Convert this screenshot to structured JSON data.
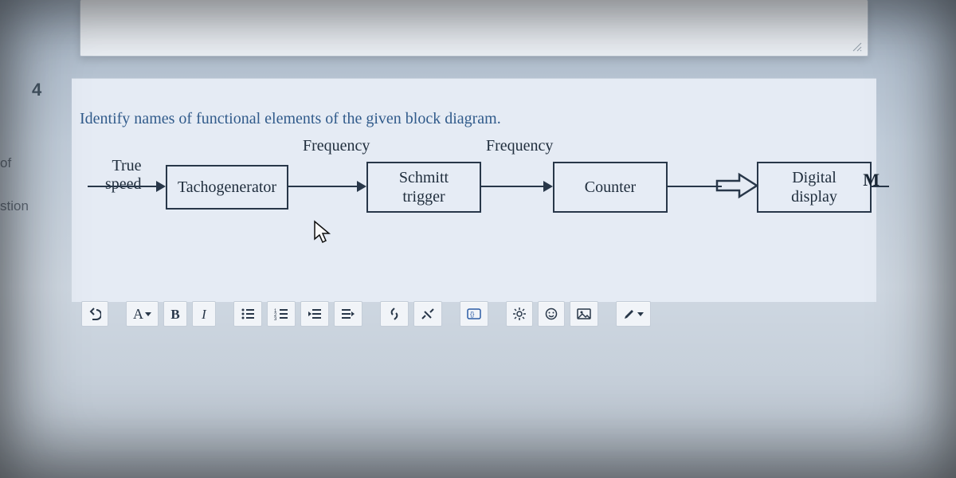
{
  "gutter": {
    "number": "4",
    "of": "of",
    "stion": "stion"
  },
  "question": {
    "prompt": "Identify names of functional elements of the given block diagram."
  },
  "diagram": {
    "input_label": "True\nspeed",
    "labels_top": {
      "freq1": "Frequency",
      "freq2": "Frequency"
    },
    "blocks": {
      "tacho": "Tachogenerator",
      "schmitt": "Schmitt\ntrigger",
      "counter": "Counter",
      "display": "Digital\ndisplay"
    },
    "output_marker": "M"
  },
  "toolbar": {
    "undo": "↶",
    "font_menu": "A",
    "bold": "B",
    "italic": "I",
    "paint_dropdown": "✎"
  },
  "icons": {
    "ul": "list-ul",
    "ol": "list-ol",
    "outdent": "outdent",
    "indent": "indent",
    "link": "link",
    "unlink": "unlink",
    "code": "code-block",
    "gear": "gear",
    "smile": "emoji",
    "image": "image"
  }
}
